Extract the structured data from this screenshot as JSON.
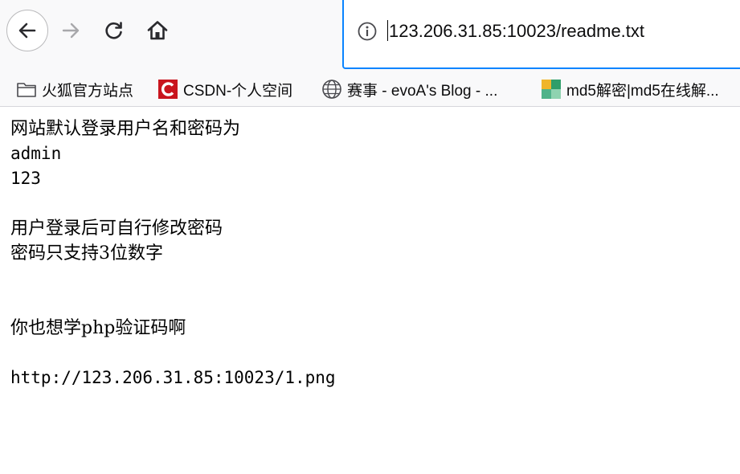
{
  "toolbar": {
    "url": "123.206.31.85:10023/readme.txt"
  },
  "bookmarks": [
    {
      "label": "火狐官方站点",
      "icon": "folder-icon"
    },
    {
      "label": "CSDN-个人空间",
      "icon": "csdn-logo-icon"
    },
    {
      "label": "赛事 - evoA's Blog - ...",
      "icon": "globe-icon"
    },
    {
      "label": "md5解密|md5在线解...",
      "icon": "cmd5-logo-icon"
    }
  ],
  "content": {
    "lines": [
      "网站默认登录用户名和密码为",
      "admin",
      "123",
      "",
      "用户登录后可自行修改密码",
      "密码只支持3位数字",
      "",
      "",
      "你也想学php验证码啊",
      "",
      "http://123.206.31.85:10023/1.png"
    ]
  },
  "colors": {
    "urlbar_focus": "#0a84ff",
    "toolbar_bg": "#f9f9fa",
    "csdn_red": "#c9151e"
  }
}
